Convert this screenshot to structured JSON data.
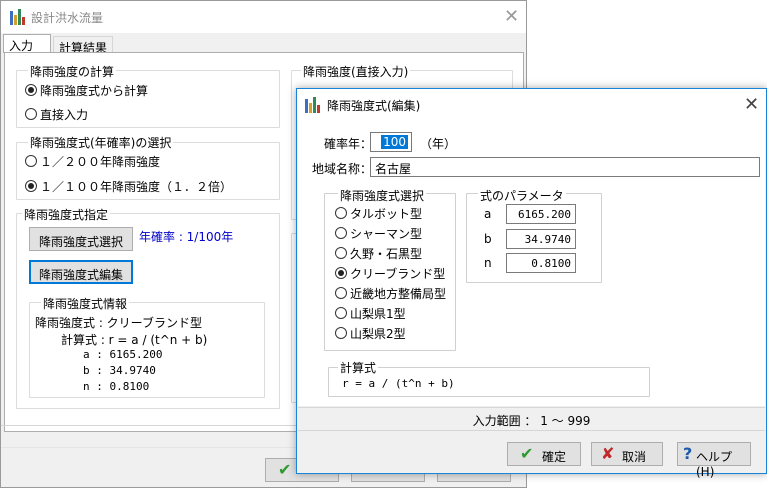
{
  "main_window": {
    "title": "設計洪水流量",
    "tabs": [
      "入力",
      "計算結果"
    ],
    "calc_group": {
      "label": "降雨強度の計算",
      "options": [
        "降雨強度式から計算",
        "直接入力"
      ]
    },
    "direct_group_label": "降雨強度(直接入力)",
    "select_group": {
      "label": "降雨強度式(年確率)の選択",
      "options": [
        "１／２００年降雨強度",
        "１／１００年降雨強度（１．２倍）"
      ]
    },
    "spec_group": {
      "label": "降雨強度式指定",
      "select_button": "降雨強度式選択",
      "probability_text": "年確率 : 1/100年",
      "edit_button": "降雨強度式編集"
    },
    "info_group": {
      "label": "降雨強度式情報",
      "line1": "降雨強度式 : クリーブランド型",
      "line2": "計算式 : r = a / (t^n + b)",
      "line_a": "a : 6165.200",
      "line_b": "b : 34.9740",
      "line_n": "n : 0.8100"
    }
  },
  "dialog": {
    "title": "降雨強度式(編集)",
    "probability_label": "確率年：",
    "probability_value": "100",
    "probability_unit": "（年）",
    "region_label": "地域名称：",
    "region_value": "名古屋",
    "formula_group": {
      "label": "降雨強度式選択",
      "options": [
        "タルボット型",
        "シャーマン型",
        "久野・石黒型",
        "クリーブランド型",
        "近畿地方整備局型",
        "山梨県1型",
        "山梨県2型"
      ],
      "selected_index": 3
    },
    "params_group": {
      "label": "式のパラメータ",
      "a_label": "a",
      "a_value": "6165.200",
      "b_label": "b",
      "b_value": "34.9740",
      "n_label": "n",
      "n_value": "0.8100"
    },
    "formula_box": {
      "label": "計算式",
      "text": "r = a / (t^n + b)"
    },
    "status": "入力範囲 ： 1 ～ 999",
    "buttons": {
      "ok": "確定",
      "cancel": "取消",
      "help": "ヘルプ(H)"
    }
  },
  "colors": {
    "accent": "#0078d7",
    "blue_text": "#0000cc",
    "ok_check": "#2e9a2e",
    "cancel_x": "#c0282a",
    "help_q": "#1e5aa8"
  }
}
